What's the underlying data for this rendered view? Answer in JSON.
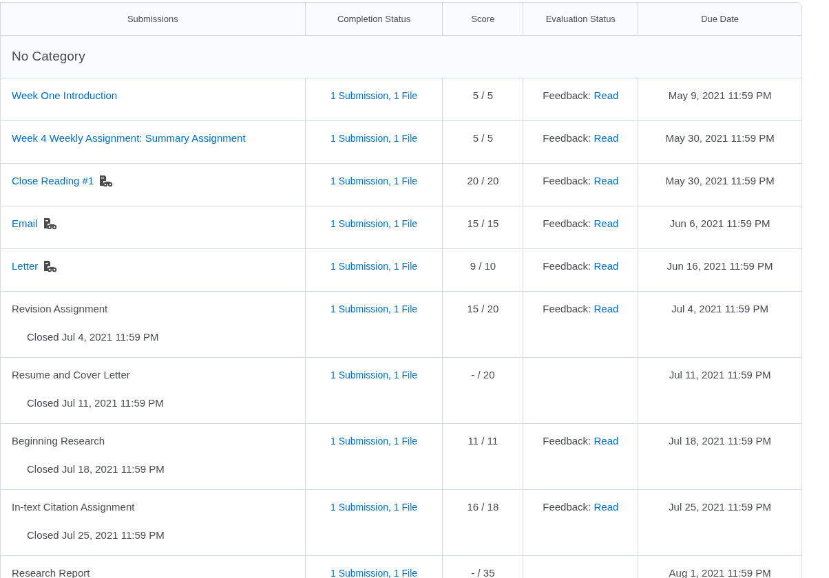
{
  "table": {
    "columns": [
      "Submissions",
      "Completion Status",
      "Score",
      "Evaluation Status",
      "Due Date"
    ],
    "category": "No Category",
    "rows": [
      {
        "name": "Week One Introduction",
        "is_link": true,
        "icon": false,
        "completion": "1 Submission, 1 File",
        "score": "5 / 5",
        "evaluation": {
          "label": "Feedback:",
          "link": "Read"
        },
        "due": "May 9, 2021 11:59 PM"
      },
      {
        "name": "Week 4 Weekly Assignment: Summary Assignment",
        "is_link": true,
        "icon": false,
        "completion": "1 Submission, 1 File",
        "score": "5 / 5",
        "evaluation": {
          "label": "Feedback:",
          "link": "Read"
        },
        "due": "May 30, 2021 11:59 PM"
      },
      {
        "name": "Close Reading #1",
        "is_link": true,
        "icon": true,
        "completion": "1 Submission, 1 File",
        "score": "20 / 20",
        "evaluation": {
          "label": "Feedback:",
          "link": "Read"
        },
        "due": "May 30, 2021 11:59 PM"
      },
      {
        "name": "Email",
        "is_link": true,
        "icon": true,
        "completion": "1 Submission, 1 File",
        "score": "15 / 15",
        "evaluation": {
          "label": "Feedback:",
          "link": "Read"
        },
        "due": "Jun 6, 2021 11:59 PM"
      },
      {
        "name": "Letter",
        "is_link": true,
        "icon": true,
        "completion": "1 Submission, 1 File",
        "score": "9 / 10",
        "evaluation": {
          "label": "Feedback:",
          "link": "Read"
        },
        "due": "Jun 16, 2021 11:59 PM"
      },
      {
        "name": "Revision Assignment",
        "is_link": false,
        "icon": false,
        "closed": "Closed Jul 4, 2021 11:59 PM",
        "completion": "1 Submission, 1 File",
        "score": "15 / 20",
        "evaluation": {
          "label": "Feedback:",
          "link": "Read"
        },
        "due": "Jul 4, 2021 11:59 PM"
      },
      {
        "name": "Resume and Cover Letter",
        "is_link": false,
        "icon": false,
        "closed": "Closed Jul 11, 2021 11:59 PM",
        "completion": "1 Submission, 1 File",
        "score": "- / 20",
        "due": "Jul 11, 2021 11:59 PM"
      },
      {
        "name": "Beginning Research",
        "is_link": false,
        "icon": false,
        "closed": "Closed Jul 18, 2021 11:59 PM",
        "completion": "1 Submission, 1 File",
        "score": "11 / 11",
        "evaluation": {
          "label": "Feedback:",
          "link": "Read"
        },
        "due": "Jul 18, 2021 11:59 PM"
      },
      {
        "name": "In-text Citation Assignment",
        "is_link": false,
        "icon": false,
        "closed": "Closed Jul 25, 2021 11:59 PM",
        "completion": "1 Submission, 1 File",
        "score": "16 / 18",
        "evaluation": {
          "label": "Feedback:",
          "link": "Read"
        },
        "due": "Jul 25, 2021 11:59 PM"
      },
      {
        "name": "Research Report",
        "is_link": false,
        "icon": false,
        "completion": "1 Submission, 1 File",
        "score": "- / 35",
        "due": "Aug 1, 2021 11:59 PM"
      }
    ]
  }
}
